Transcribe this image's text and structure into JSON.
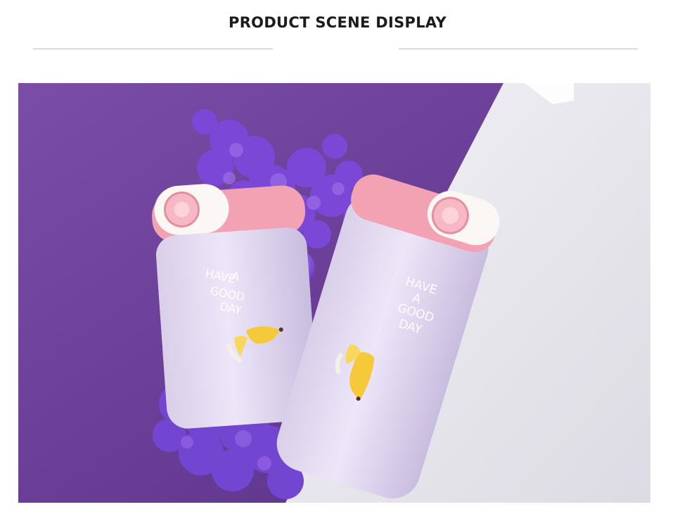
{
  "header": {
    "title": "PRODUCT SCENE DISPLAY"
  },
  "photo": {
    "bottle_text_line1": "HAVE",
    "bottle_text_line2": "A",
    "bottle_text_line3": "GOOD",
    "bottle_text_line4": "DAY",
    "colors": {
      "purple_backdrop": "#6b3e9b",
      "white_surface": "#eceaf0",
      "bottle_body": "#e6dcf4",
      "lid_pink": "#f2a2b2",
      "flowers": "#7b47d6",
      "banana": "#f5c93a"
    }
  }
}
